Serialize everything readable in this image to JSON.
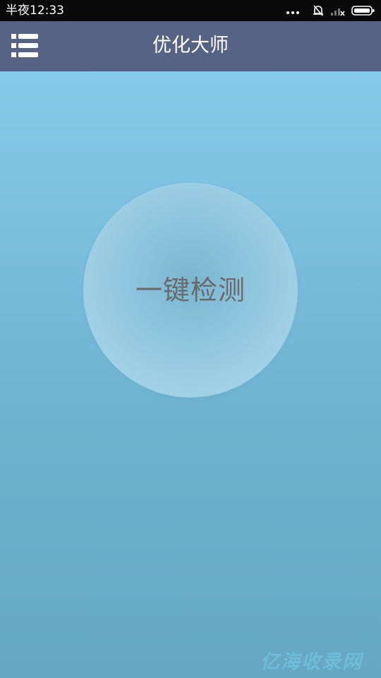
{
  "status_bar": {
    "time": "半夜12:33",
    "icons": [
      "more-dots-icon",
      "alarm-off-icon",
      "signal-icon",
      "battery-icon"
    ]
  },
  "header": {
    "title": "优化大师",
    "menu_icon": "list-menu-icon"
  },
  "main": {
    "detect_button_label": "一键检测"
  },
  "watermark": {
    "text": "亿海收录网"
  },
  "colors": {
    "status_bar_bg": "#0a0a0a",
    "title_bar_bg": "#566384",
    "background_top": "#8ccff0",
    "background_bottom": "#66a8c4",
    "circle_text": "#6a6a6a"
  }
}
